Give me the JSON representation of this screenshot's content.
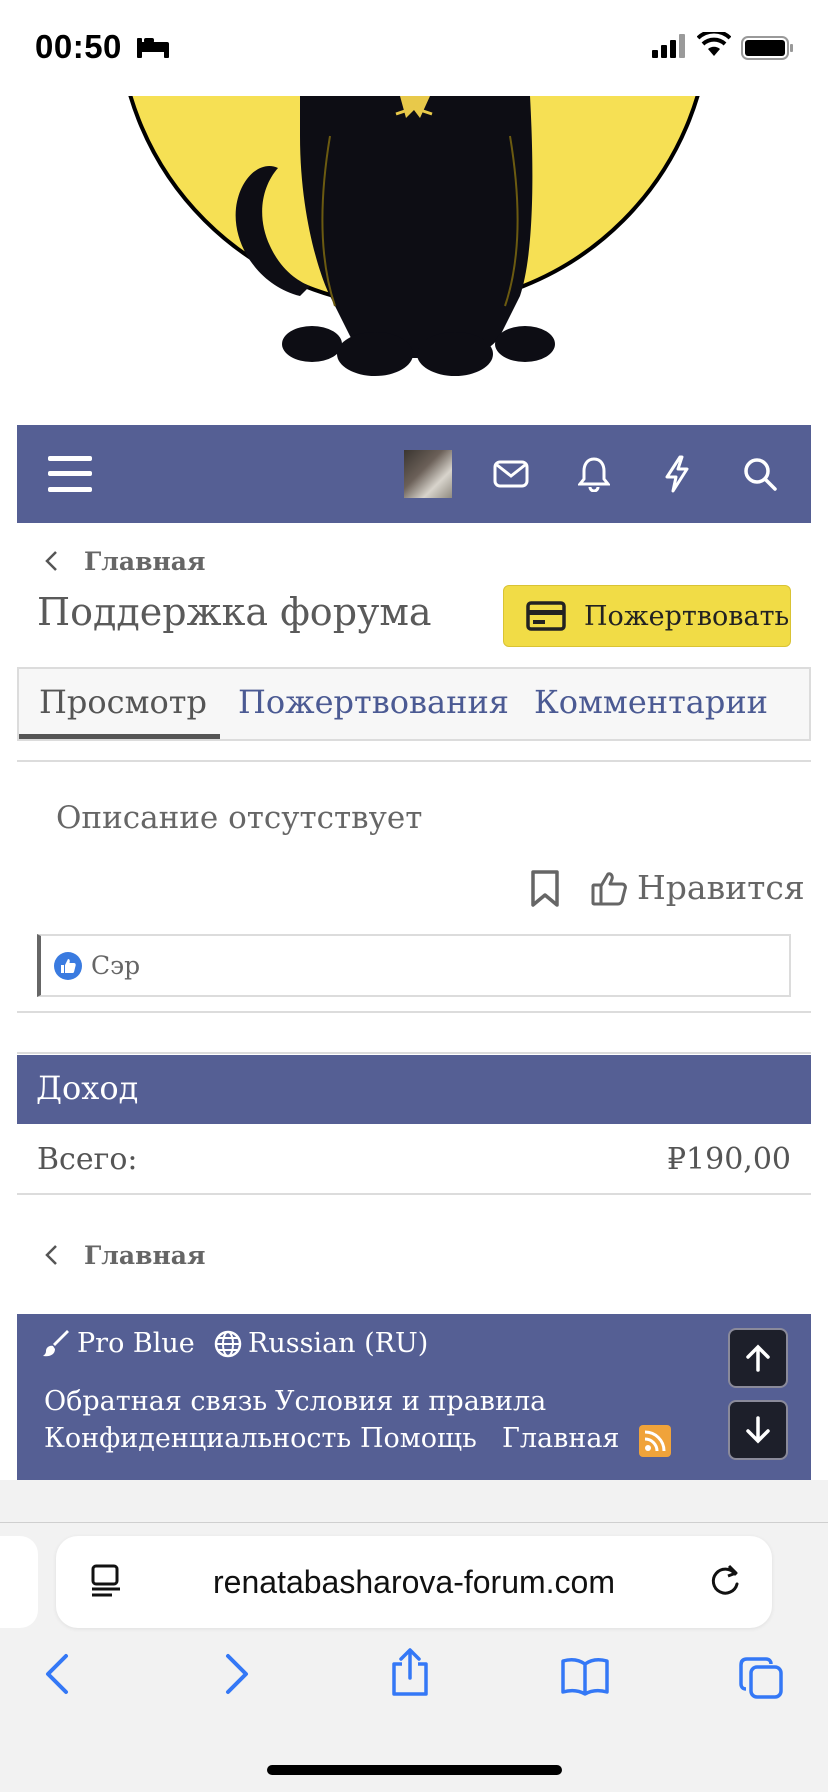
{
  "status_bar": {
    "time": "00:50"
  },
  "header": {
    "nav_icons": [
      "menu-icon",
      "avatar",
      "mail-icon",
      "bell-icon",
      "bolt-icon",
      "search-icon"
    ]
  },
  "breadcrumb": {
    "label": "Главная"
  },
  "page": {
    "title": "Поддержка форума",
    "donate_label": "Пожертвовать"
  },
  "tabs": [
    {
      "label": "Просмотр",
      "active": true
    },
    {
      "label": "Пожертвования",
      "active": false
    },
    {
      "label": "Комментарии",
      "active": false
    }
  ],
  "content": {
    "description": "Описание отсутствует",
    "like_label": "Нравится",
    "likes_user": "Сэр"
  },
  "income": {
    "title": "Доход",
    "total_label": "Всего:",
    "total_value": "₽190,00"
  },
  "footer": {
    "style": "Pro Blue",
    "language": "Russian (RU)",
    "links": [
      "Обратная связь",
      "Условия и правила",
      "Конфиденциальность",
      "Помощь",
      "Главная"
    ]
  },
  "browser": {
    "url": "renatabasharova-forum.com"
  },
  "colors": {
    "nav": "#555f94",
    "donate": "#f1dc46",
    "tab_link": "#4b5a93"
  }
}
